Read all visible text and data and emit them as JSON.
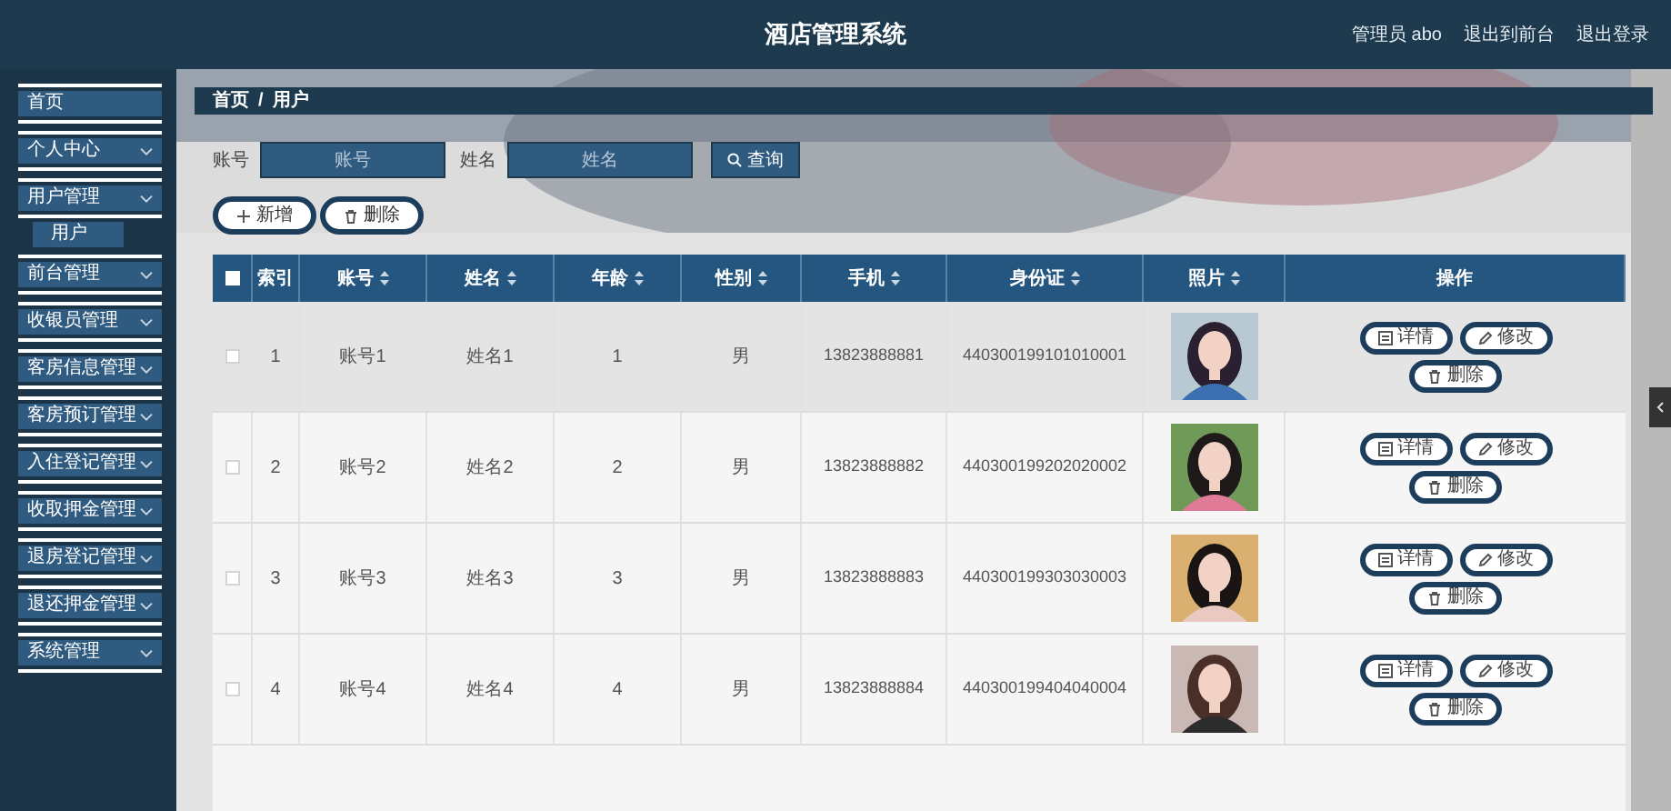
{
  "header": {
    "title": "酒店管理系统",
    "user": "管理员 abo",
    "links": [
      "退出到前台",
      "退出登录"
    ]
  },
  "sidebar": {
    "items": [
      {
        "label": "首页",
        "kind": "link"
      },
      {
        "label": "个人中心",
        "kind": "menu"
      },
      {
        "label": "用户管理",
        "kind": "menu",
        "children": [
          {
            "label": "用户",
            "selected": true
          }
        ]
      },
      {
        "label": "前台管理",
        "kind": "menu"
      },
      {
        "label": "收银员管理",
        "kind": "menu"
      },
      {
        "label": "客房信息管理",
        "kind": "menu"
      },
      {
        "label": "客房预订管理",
        "kind": "menu"
      },
      {
        "label": "入住登记管理",
        "kind": "menu"
      },
      {
        "label": "收取押金管理",
        "kind": "menu"
      },
      {
        "label": "退房登记管理",
        "kind": "menu"
      },
      {
        "label": "退还押金管理",
        "kind": "menu"
      },
      {
        "label": "系统管理",
        "kind": "menu"
      }
    ]
  },
  "breadcrumb": {
    "items": [
      "首页",
      "用户"
    ],
    "separator": "/"
  },
  "search": {
    "fields": [
      {
        "label": "账号",
        "placeholder": "账号"
      },
      {
        "label": "姓名",
        "placeholder": "姓名"
      }
    ],
    "button": "查询"
  },
  "toolbar": [
    {
      "kind": "add",
      "label": "新增"
    },
    {
      "kind": "delete",
      "label": "删除"
    }
  ],
  "table": {
    "select_all": {
      "checked": false
    },
    "columns": [
      {
        "label": "索引",
        "sortable": false
      },
      {
        "label": "账号",
        "sortable": true
      },
      {
        "label": "姓名",
        "sortable": true
      },
      {
        "label": "年龄",
        "sortable": true
      },
      {
        "label": "性别",
        "sortable": true
      },
      {
        "label": "手机",
        "sortable": true
      },
      {
        "label": "身份证",
        "sortable": true
      },
      {
        "label": "照片",
        "sortable": true
      },
      {
        "label": "操作",
        "sortable": false
      }
    ],
    "rows": [
      {
        "checked": false,
        "hovered": true,
        "cells": [
          "1",
          "账号1",
          "姓名1",
          "1",
          "男",
          "13823888881",
          "440300199101010001"
        ],
        "actions": [
          {
            "kind": "detail",
            "label": "详情"
          },
          {
            "kind": "edit",
            "label": "修改"
          },
          {
            "kind": "delete",
            "label": "删除"
          }
        ]
      },
      {
        "checked": false,
        "hovered": false,
        "cells": [
          "2",
          "账号2",
          "姓名2",
          "2",
          "男",
          "13823888882",
          "440300199202020002"
        ],
        "actions": [
          {
            "kind": "detail",
            "label": "详情"
          },
          {
            "kind": "edit",
            "label": "修改"
          },
          {
            "kind": "delete",
            "label": "删除"
          }
        ]
      },
      {
        "checked": false,
        "hovered": false,
        "cells": [
          "3",
          "账号3",
          "姓名3",
          "3",
          "男",
          "13823888883",
          "440300199303030003"
        ],
        "actions": [
          {
            "kind": "detail",
            "label": "详情"
          },
          {
            "kind": "edit",
            "label": "修改"
          },
          {
            "kind": "delete",
            "label": "删除"
          }
        ]
      },
      {
        "checked": false,
        "hovered": false,
        "cells": [
          "4",
          "账号4",
          "姓名4",
          "4",
          "男",
          "13823888884",
          "440300199404040004"
        ],
        "actions": [
          {
            "kind": "detail",
            "label": "详情"
          },
          {
            "kind": "edit",
            "label": "修改"
          },
          {
            "kind": "delete",
            "label": "删除"
          }
        ]
      }
    ]
  }
}
